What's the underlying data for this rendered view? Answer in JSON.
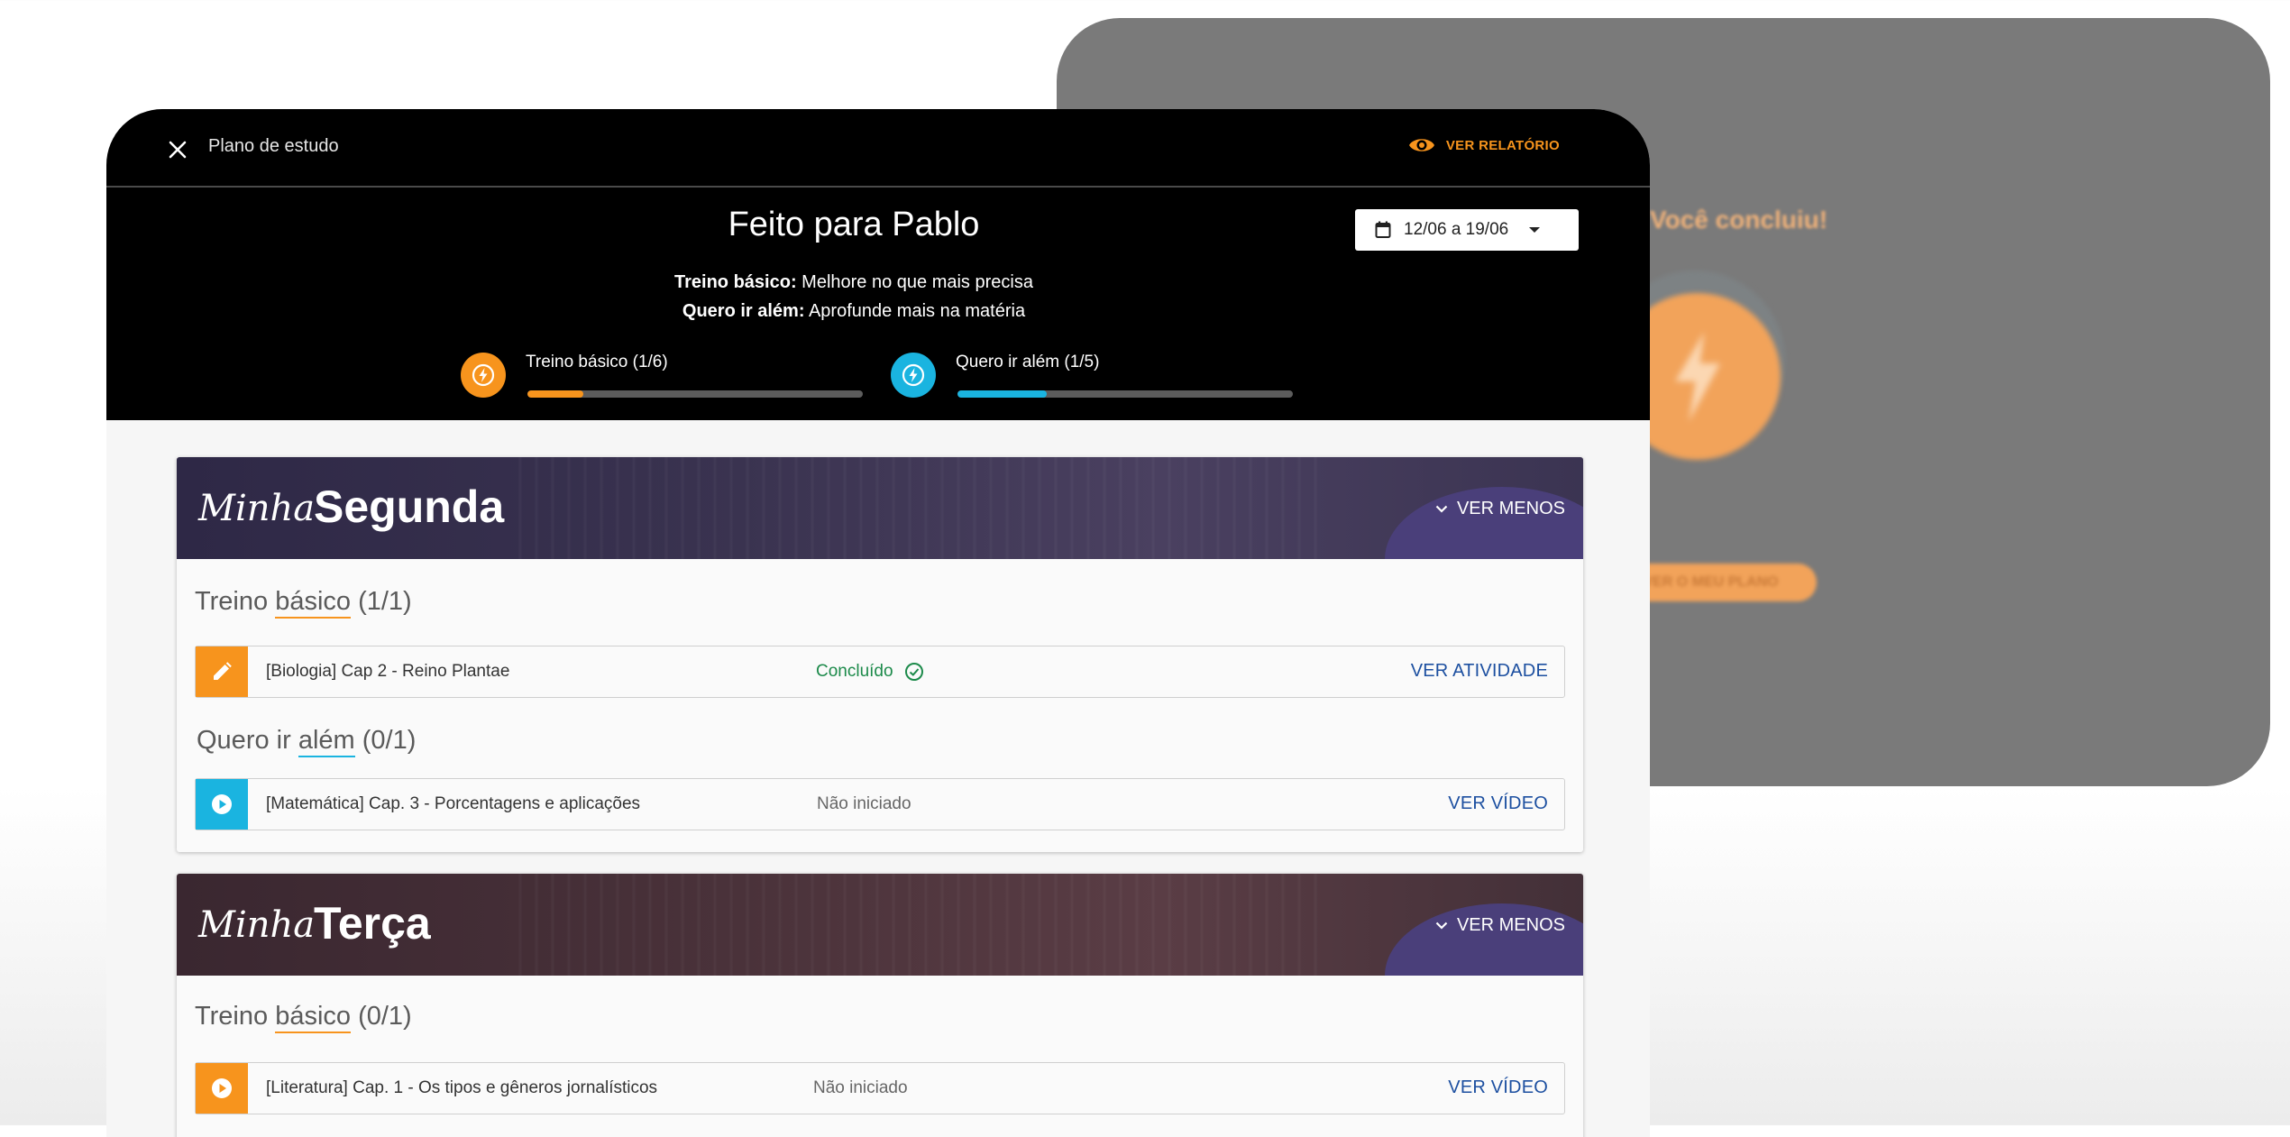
{
  "background_card": {
    "text": "Você concluiu!",
    "button_label": "VER O MEU PLANO"
  },
  "header": {
    "title": "Plano de estudo",
    "report_label": "VER RELATÓRIO",
    "heading": "Feito para Pablo",
    "line1_bold": "Treino básico:",
    "line1_text": " Melhore no que mais precisa",
    "line2_bold": "Quero ir além:",
    "line2_text": " Aprofunde mais na matéria",
    "date_range": "12/06 a 19/06"
  },
  "progress": [
    {
      "label": "Treino básico (1/6)",
      "value": 0.1667,
      "color": "#f7941d"
    },
    {
      "label": "Quero ir além  (1/5)",
      "value": 0.2667,
      "color": "#1ab4e0"
    }
  ],
  "colors": {
    "orange": "#f7941d",
    "blue": "#1ab4e0",
    "done_green": "#1c8a4a",
    "link_blue": "#1c4fa0",
    "monday_header": "#3d3552",
    "tuesday_header": "#4a3239"
  },
  "days": [
    {
      "prefix": "Minha",
      "name": "Segunda",
      "collapse_label": "VER MENOS",
      "basic_title_pre": "Treino ",
      "basic_title_u": "básico",
      "basic_title_post": " (1/1)",
      "basic_row": {
        "icon": "pencil-icon",
        "title": "[Biologia] Cap 2 - Reino Plantae",
        "status": "Concluído",
        "action": "VER ATIVIDADE"
      },
      "extra_title_pre": "Quero ir ",
      "extra_title_u": "além",
      "extra_title_post": " (0/1)",
      "extra_row": {
        "icon": "play-icon",
        "title": "[Matemática] Cap. 3 - Porcentagens e aplicações",
        "status": "Não iniciado",
        "action": "VER VÍDEO"
      }
    },
    {
      "prefix": "Minha",
      "name": "Terça",
      "collapse_label": "VER MENOS",
      "basic_title_pre": "Treino ",
      "basic_title_u": "básico",
      "basic_title_post": " (0/1)",
      "basic_row": {
        "icon": "play-icon",
        "title": "[Literatura] Cap. 1 -  Os tipos e gêneros jornalísticos",
        "status": "Não iniciado",
        "action": "VER VÍDEO"
      }
    }
  ]
}
